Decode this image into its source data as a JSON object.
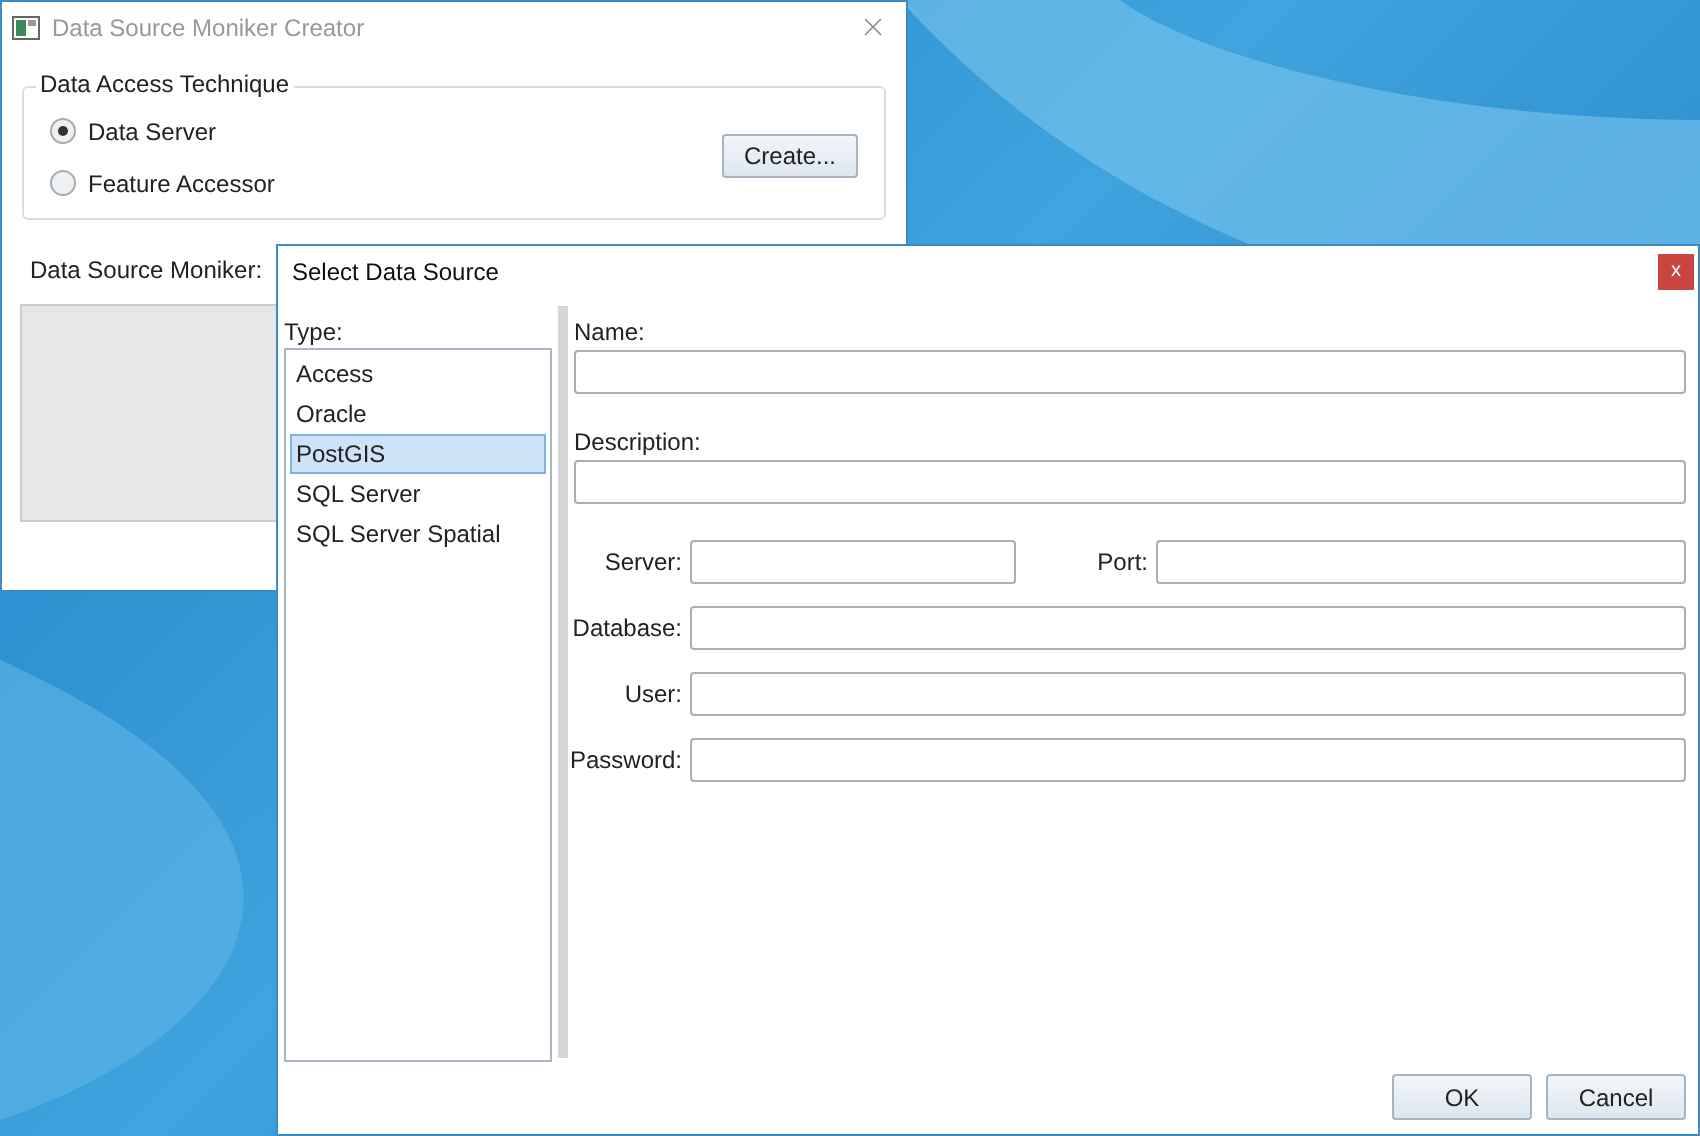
{
  "main_window": {
    "title": "Data Source Moniker Creator",
    "group": {
      "title": "Data Access Technique",
      "options": [
        {
          "label": "Data Server",
          "selected": true
        },
        {
          "label": "Feature Accessor",
          "selected": false
        }
      ],
      "button": "Create..."
    },
    "moniker_label": "Data Source Moniker:"
  },
  "dialog": {
    "title": "Select Data Source",
    "close": "x",
    "type_label": "Type:",
    "types": [
      {
        "label": "Access",
        "selected": false
      },
      {
        "label": "Oracle",
        "selected": false
      },
      {
        "label": "PostGIS",
        "selected": true
      },
      {
        "label": "SQL Server",
        "selected": false
      },
      {
        "label": "SQL Server Spatial",
        "selected": false
      }
    ],
    "fields": [
      {
        "kind": "stacked",
        "label": "Name:"
      },
      {
        "kind": "stacked",
        "label": "Description:"
      },
      {
        "kind": "pair",
        "label": "Server:",
        "second_label": "Port:"
      },
      {
        "kind": "inline",
        "label": "Database:"
      },
      {
        "kind": "inline",
        "label": "User:"
      },
      {
        "kind": "inline",
        "label": "Password:"
      }
    ],
    "buttons": [
      "OK",
      "Cancel"
    ]
  }
}
